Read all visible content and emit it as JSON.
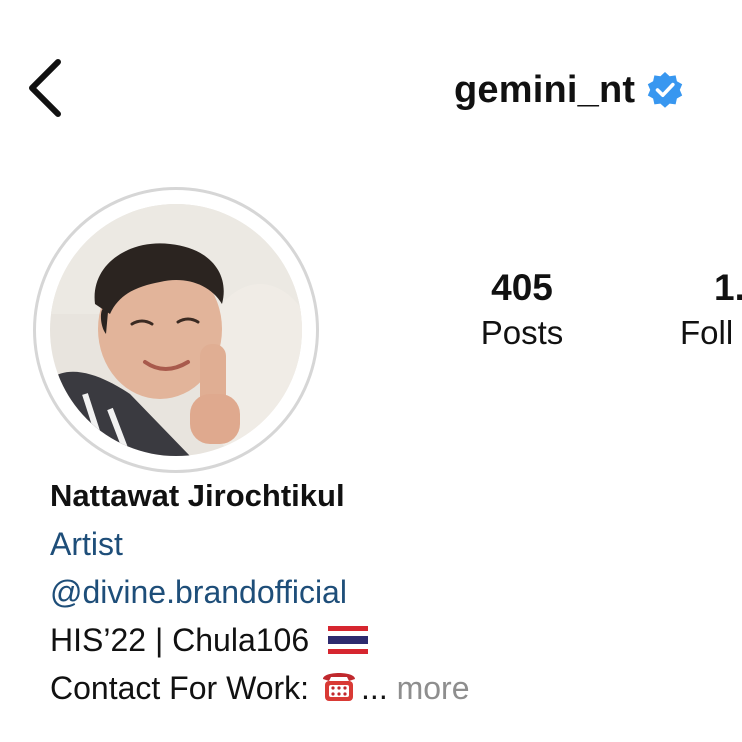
{
  "header": {
    "username": "gemini_nt",
    "verified_color": "#3897f0",
    "back_icon": "chevron-left-icon"
  },
  "stats": {
    "posts_count": "405",
    "posts_label": "Posts",
    "followers_count": "1.",
    "followers_label": "Foll"
  },
  "bio": {
    "name": "Nattawat Jirochtikul",
    "category": "Artist",
    "mention": "@divine.brandofficial",
    "line1": "HIS’22 | Chula106",
    "line2": "Contact For Work:",
    "ellipsis": "...",
    "more_label": "more",
    "link_color": "#1e4e79"
  }
}
